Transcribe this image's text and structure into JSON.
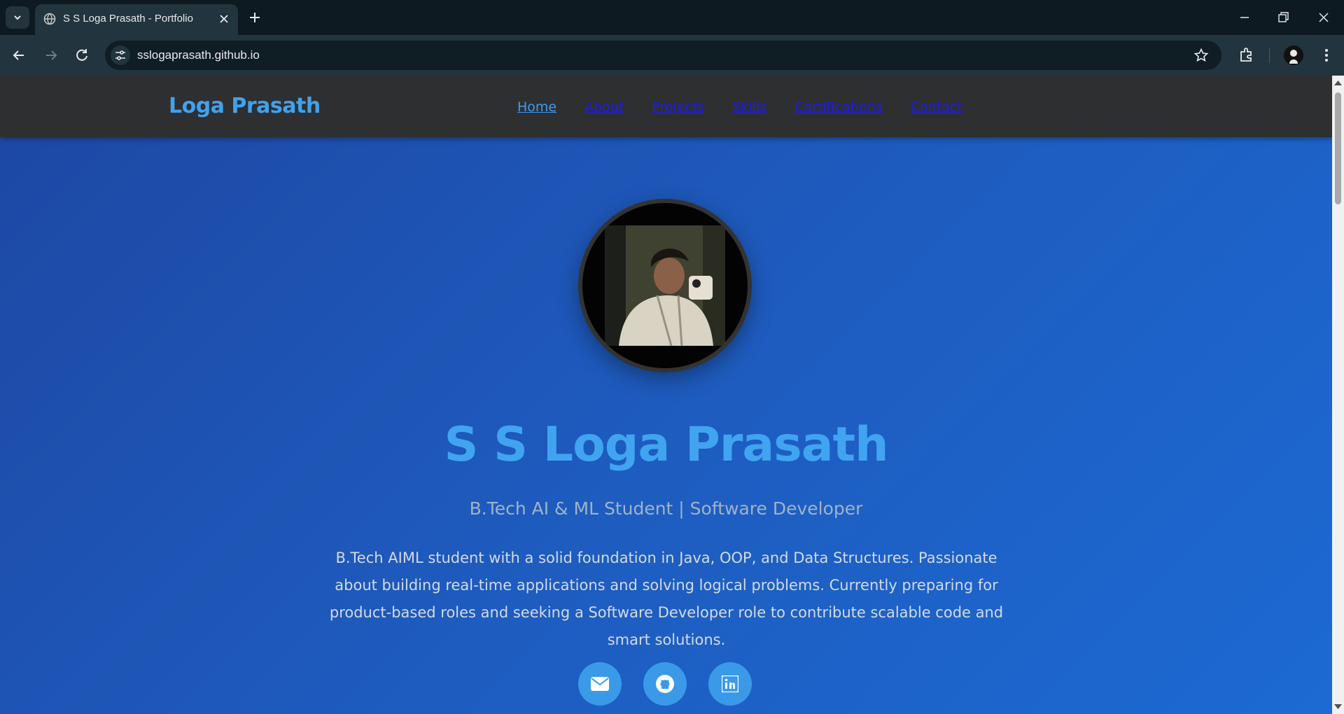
{
  "browser": {
    "tab_title": "S S Loga Prasath - Portfolio",
    "url": "sslogaprasath.github.io"
  },
  "site": {
    "brand": "Loga Prasath",
    "nav": [
      "Home",
      "About",
      "Projects",
      "Skills",
      "Certifications",
      "Contact"
    ],
    "name": "S S Loga Prasath",
    "subtitle": "B.Tech AI & ML Student | Software Developer",
    "description": "B.Tech AIML student with a solid foundation in Java, OOP, and Data Structures. Passionate about building real-time applications and solving logical problems. Currently preparing for product-based roles and seeking a Software Developer role to contribute scalable code and smart solutions.",
    "social": [
      "mail-icon",
      "github-icon",
      "linkedin-icon"
    ]
  },
  "colors": {
    "accent": "#40a4f0",
    "link": "#1d1ee0",
    "nav_bg": "#2e2f31"
  }
}
